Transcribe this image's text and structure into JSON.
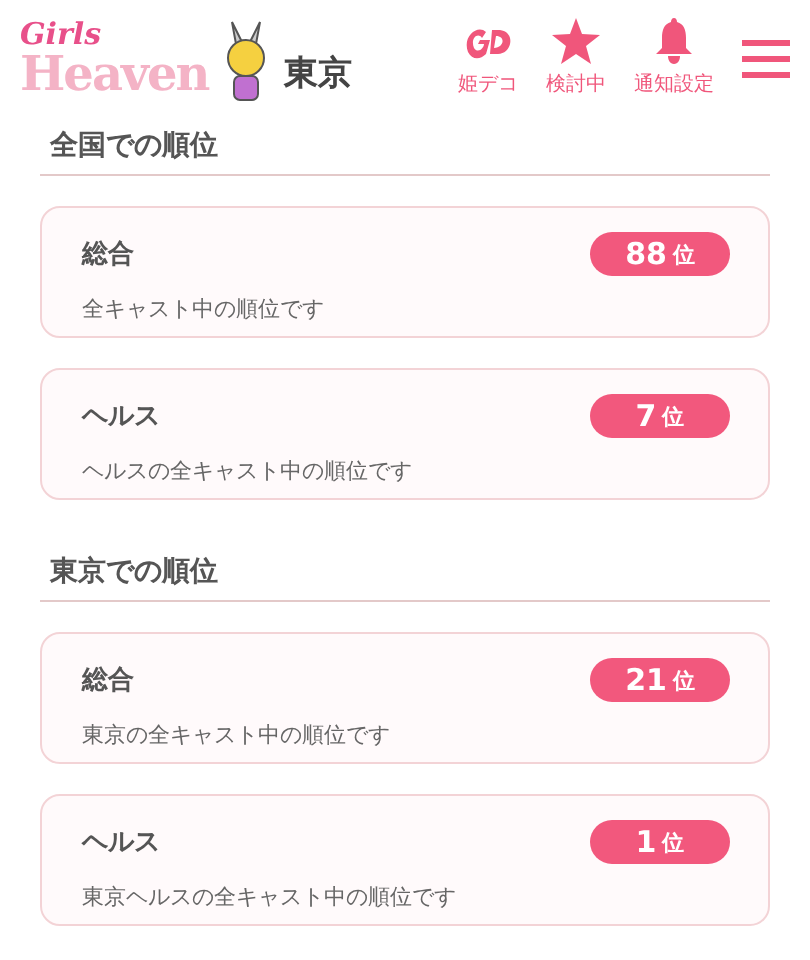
{
  "header": {
    "logo": {
      "top": "Girls",
      "bottom": "Heaven",
      "area": "東京"
    },
    "nav": [
      {
        "kind": "deco",
        "label": "姫デコ"
      },
      {
        "kind": "star",
        "label": "検討中"
      },
      {
        "kind": "bell",
        "label": "通知設定"
      }
    ]
  },
  "sections": [
    {
      "title": "全国での順位",
      "cards": [
        {
          "name": "総合",
          "rank": "88",
          "unit": "位",
          "note": "全キャスト中の順位です"
        },
        {
          "name": "ヘルス",
          "rank": "7",
          "unit": "位",
          "note": "ヘルスの全キャスト中の順位です"
        }
      ]
    },
    {
      "title": "東京での順位",
      "cards": [
        {
          "name": "総合",
          "rank": "21",
          "unit": "位",
          "note": "東京の全キャスト中の順位です"
        },
        {
          "name": "ヘルス",
          "rank": "1",
          "unit": "位",
          "note": "東京ヘルスの全キャスト中の順位です"
        }
      ]
    }
  ]
}
